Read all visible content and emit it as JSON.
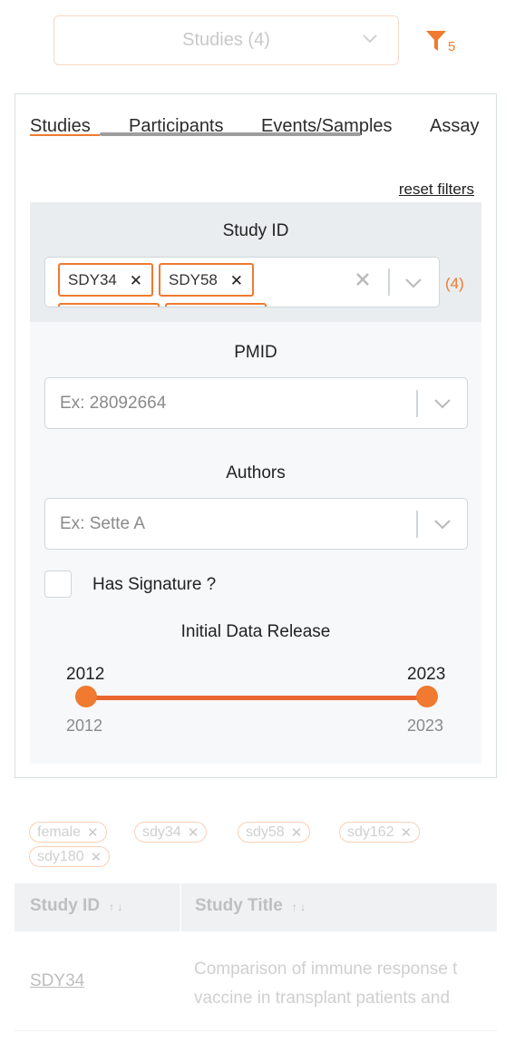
{
  "top_bar": {
    "dataset_select": "Studies (4)",
    "filter_count": "5",
    "accent_color": "#f07a2f"
  },
  "tabs": [
    {
      "label": "Studies",
      "active": true
    },
    {
      "label": "Participants",
      "active": false
    },
    {
      "label": "Events/Samples",
      "active": false
    },
    {
      "label": "Assay",
      "active": false
    }
  ],
  "reset_filters": "reset filters",
  "filters": {
    "study_id": {
      "title": "Study ID",
      "chips": [
        "SDY34",
        "SDY58"
      ],
      "count": "(4)"
    },
    "pmid": {
      "title": "PMID",
      "placeholder": "Ex: 28092664"
    },
    "authors": {
      "title": "Authors",
      "placeholder": "Ex: Sette A"
    },
    "has_signature": {
      "label": "Has Signature ?",
      "checked": false
    },
    "initial_release": {
      "title": "Initial Data Release",
      "selected_min": "2012",
      "selected_max": "2023",
      "range_min": "2012",
      "range_max": "2023"
    }
  },
  "active_tags": [
    "female",
    "sdy34",
    "sdy58",
    "sdy162",
    "sdy180"
  ],
  "table": {
    "columns": [
      "Study ID",
      "Study Title"
    ],
    "rows": [
      {
        "study_id": "SDY34",
        "title_line1": "Comparison of immune response t",
        "title_line2": "vaccine in transplant patients and"
      }
    ]
  }
}
